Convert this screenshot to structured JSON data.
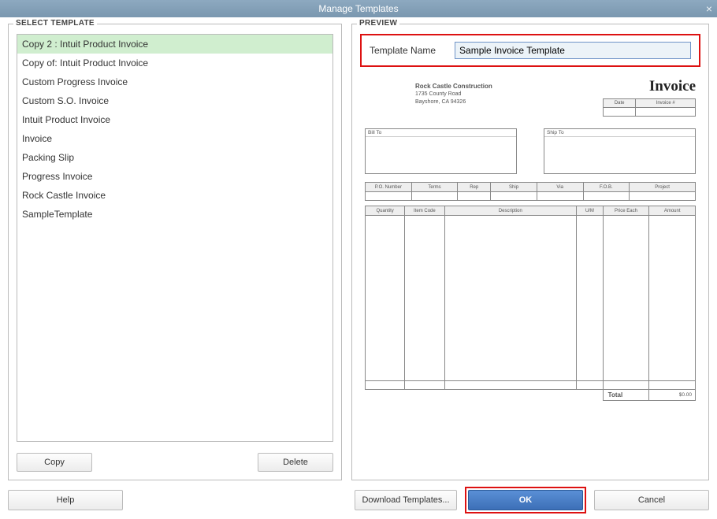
{
  "window": {
    "title": "Manage Templates"
  },
  "left": {
    "legend": "SELECT TEMPLATE",
    "items": [
      "Copy 2 : Intuit Product Invoice",
      "Copy of: Intuit Product Invoice",
      "Custom Progress Invoice",
      "Custom S.O. Invoice",
      "Intuit Product Invoice",
      "Invoice",
      "Packing Slip",
      "Progress Invoice",
      "Rock Castle Invoice",
      "SampleTemplate"
    ],
    "selected_index": 0,
    "copy_label": "Copy",
    "delete_label": "Delete"
  },
  "right": {
    "legend": "PREVIEW",
    "name_label": "Template Name",
    "name_value": "Sample Invoice Template"
  },
  "preview": {
    "company": {
      "name": "Rock Castle Construction",
      "addr1": "1735 County Road",
      "addr2": "Bayshore, CA 94326"
    },
    "title": "Invoice",
    "date_inv_headers": [
      "Date",
      "Invoice #"
    ],
    "billto": "Bill To",
    "shipto": "Ship To",
    "row1_headers": [
      "P.O. Number",
      "Terms",
      "Rep",
      "Ship",
      "Via",
      "F.O.B.",
      "Project"
    ],
    "row2_headers": [
      "Quantity",
      "Item Code",
      "Description",
      "U/M",
      "Price Each",
      "Amount"
    ],
    "total_label": "Total",
    "total_value": "$0.00"
  },
  "footer": {
    "help": "Help",
    "download": "Download Templates...",
    "ok": "OK",
    "cancel": "Cancel"
  }
}
